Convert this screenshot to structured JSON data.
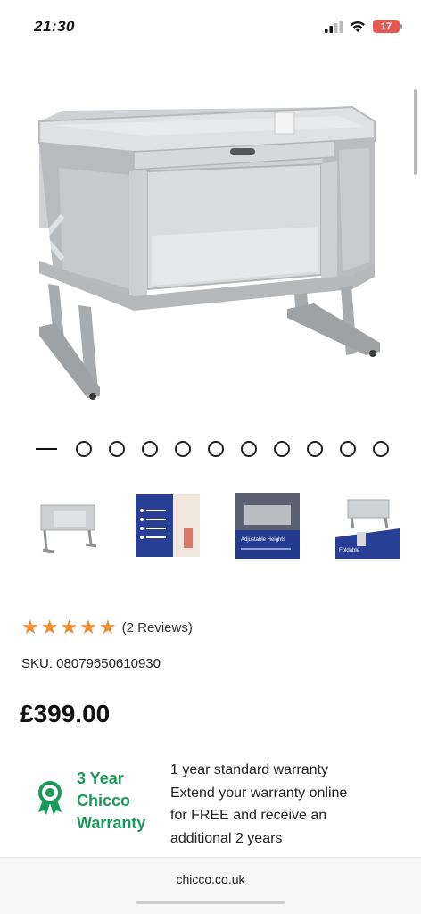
{
  "status_bar": {
    "time": "21:30",
    "battery": "17"
  },
  "product": {
    "carousel": {
      "slide_count": 11,
      "active_index": 0
    },
    "thumbnails": [
      "crib-front",
      "features-sheet",
      "room-photo",
      "folded-crib"
    ],
    "thumbnail_captions": {
      "room": "Adjustable Heights",
      "fold": "Foldable"
    },
    "rating": {
      "stars": 5,
      "reviews_label": "(2 Reviews)"
    },
    "sku_label": "SKU: 08079650610930",
    "price": "£399.00",
    "warranty": {
      "title_line1": "3 Year",
      "title_line2": "Chicco",
      "title_line3": "Warranty",
      "text_line1": "1 year standard warranty",
      "text_line2": "Extend your warranty online",
      "text_line3": "for FREE and receive an",
      "text_line4": "additional 2 years",
      "accent_color": "#1a9a5a"
    }
  },
  "browser": {
    "url": "chicco.co.uk"
  },
  "colors": {
    "star": "#f08a2d",
    "battery": "#e25a4f"
  }
}
